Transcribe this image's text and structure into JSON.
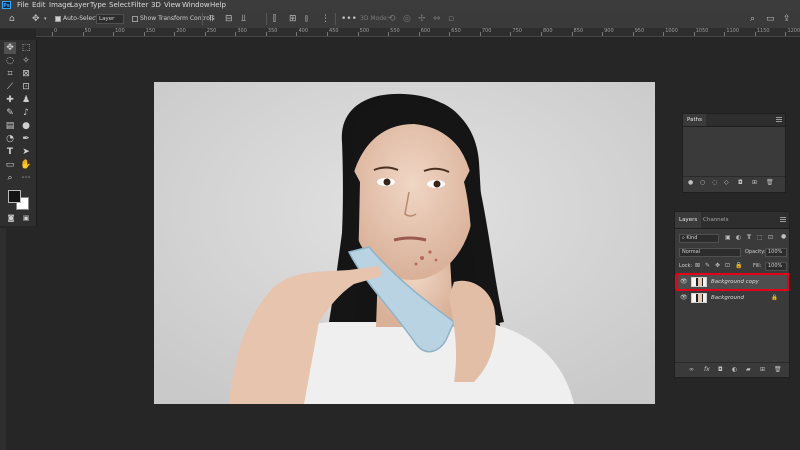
{
  "app": {
    "logo": "Ps"
  },
  "menu": [
    "File",
    "Edit",
    "Image",
    "Layer",
    "Type",
    "Select",
    "Filter",
    "3D",
    "View",
    "Window",
    "Help"
  ],
  "options_bar": {
    "auto_select_label": "Auto-Select",
    "auto_select_checked": true,
    "auto_select_target": "Layer",
    "show_transform_label": "Show Transform Controls",
    "show_transform_checked": false,
    "mode_3d_label": "3D Mode:"
  },
  "ruler": {
    "top_ticks": [
      "0",
      "50",
      "100",
      "150",
      "200",
      "250",
      "300",
      "350",
      "400",
      "450",
      "500",
      "550",
      "600",
      "650",
      "700",
      "750",
      "800",
      "850",
      "900",
      "950",
      "1000",
      "1050",
      "1100",
      "1150",
      "1200"
    ]
  },
  "paths_panel": {
    "title": "Paths"
  },
  "layers_panel": {
    "tabs": [
      "Layers",
      "Channels"
    ],
    "filter_label": "Kind",
    "blend_mode": "Normal",
    "opacity_label": "Opacity:",
    "opacity_value": "100%",
    "lock_label": "Lock:",
    "fill_label": "Fill:",
    "fill_value": "100%",
    "layers": [
      {
        "name": "Background copy",
        "selected": true,
        "locked": false
      },
      {
        "name": "Background",
        "selected": false,
        "locked": true
      }
    ]
  },
  "colors": {
    "highlight_box": "#e3001b",
    "ps_blue": "#31a8ff"
  }
}
